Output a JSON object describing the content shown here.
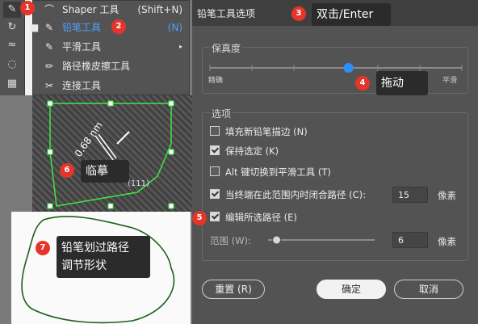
{
  "flyout": {
    "items": [
      {
        "icon": "shaper-icon",
        "label": "Shaper 工具",
        "shortcut": "(Shift+N)",
        "selected": false
      },
      {
        "icon": "pencil-icon",
        "label": "铅笔工具",
        "shortcut": "(N)",
        "selected": true
      },
      {
        "icon": "smooth-icon",
        "label": "平滑工具",
        "shortcut": "",
        "selected": false
      },
      {
        "icon": "path-eraser-icon",
        "label": "路径橡皮擦工具",
        "shortcut": "",
        "selected": false
      },
      {
        "icon": "join-icon",
        "label": "连接工具",
        "shortcut": "",
        "selected": false
      }
    ]
  },
  "canvas": {
    "tem_label_size": "0.68 nm",
    "tem_label_plane": "(111)"
  },
  "dialog": {
    "title": "铅笔工具选项",
    "fidelity": {
      "label": "保真度",
      "left": "精确",
      "right": "平滑",
      "level": 0.55
    },
    "options": {
      "label": "选项",
      "fill_new": {
        "label": "填充新铅笔描边 (N)",
        "checked": false
      },
      "keep_selected": {
        "label": "保持选定 (K)",
        "checked": true
      },
      "alt_toggle": {
        "label": "Alt 键切换到平滑工具 (T)",
        "checked": false
      },
      "close_paths": {
        "label": "当终端在此范围内时闭合路径 (C):",
        "checked": true,
        "value": "15",
        "unit": "像素"
      },
      "edit_selected": {
        "label": "编辑所选路径 (E)",
        "checked": true
      },
      "range": {
        "label": "范围 (W):",
        "value": "6",
        "unit": "像素",
        "level": 0.08
      }
    },
    "buttons": {
      "reset": "重置 (R)",
      "ok": "确定",
      "cancel": "取消"
    }
  },
  "annotations": {
    "b1": "1",
    "b2": "2",
    "b3": "3",
    "b4": "4",
    "b5": "5",
    "b6": "6",
    "b7": "7",
    "c3": "双击/Enter",
    "c4": "拖动",
    "c6": "临摹",
    "c7_line1": "铅笔划过路径",
    "c7_line2": "调节形状",
    "accent_color": "#e5352b"
  }
}
